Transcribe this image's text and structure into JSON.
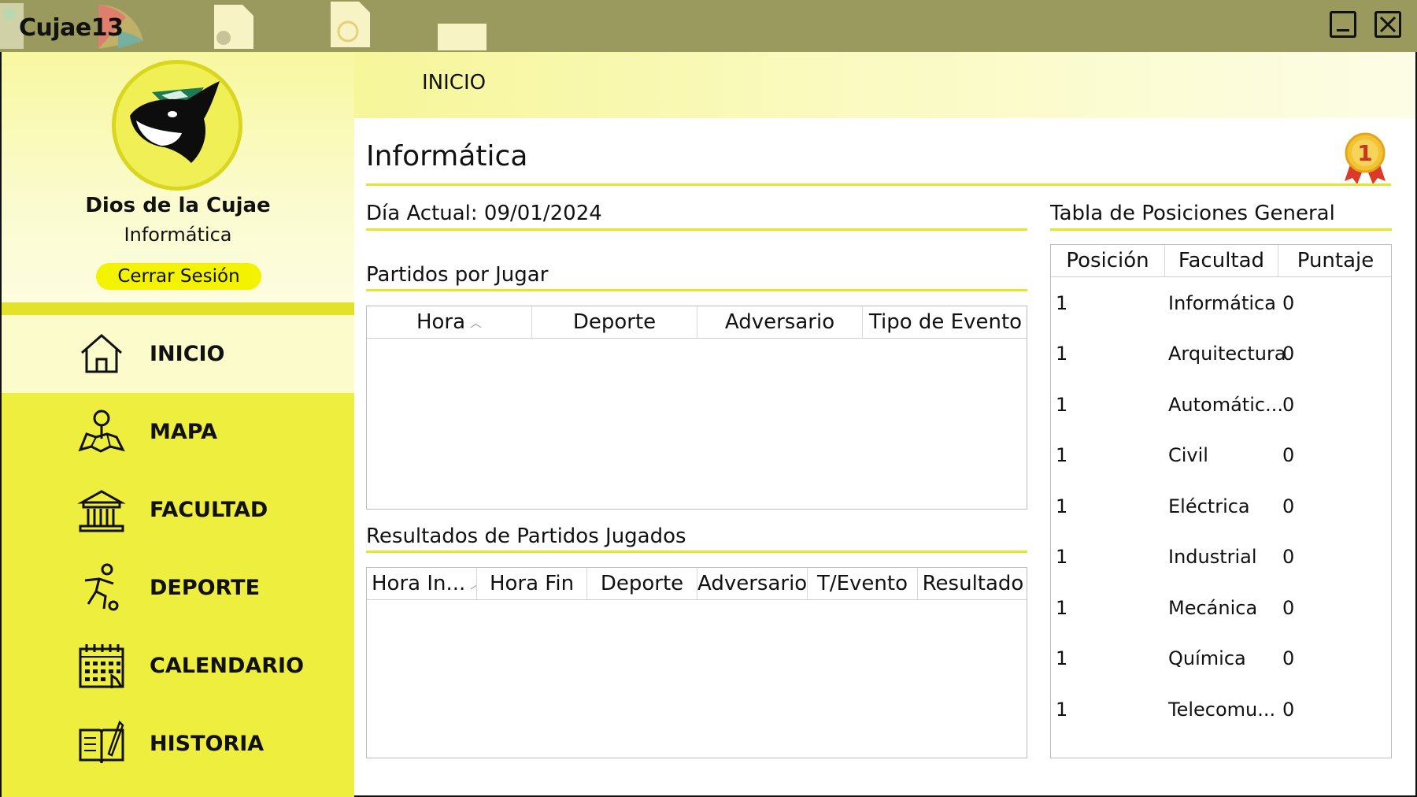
{
  "window": {
    "title": "Cujae13"
  },
  "user": {
    "name": "Dios de la Cujae",
    "faculty": "Informática",
    "logout_label": "Cerrar Sesión"
  },
  "nav": [
    {
      "label": "INICIO",
      "icon": "home-icon",
      "active": true
    },
    {
      "label": "MAPA",
      "icon": "map-icon",
      "active": false
    },
    {
      "label": "FACULTAD",
      "icon": "building-icon",
      "active": false
    },
    {
      "label": "DEPORTE",
      "icon": "soccer-player-icon",
      "active": false
    },
    {
      "label": "CALENDARIO",
      "icon": "calendar-icon",
      "active": false
    },
    {
      "label": "HISTORIA",
      "icon": "book-icon",
      "active": false
    }
  ],
  "header": {
    "title": "INICIO"
  },
  "main": {
    "title": "Informática",
    "current_day": "Día Actual: 09/01/2024",
    "upcoming": {
      "title": "Partidos por Jugar",
      "columns": [
        "Hora",
        "Deporte",
        "Adversario",
        "Tipo de Evento"
      ],
      "rows": []
    },
    "results": {
      "title": "Resultados de Partidos Jugados",
      "columns": [
        "Hora In...",
        "Hora Fin",
        "Deporte",
        "Adversario",
        "T/Evento",
        "Resultado"
      ],
      "rows": []
    },
    "standings": {
      "title": "Tabla de Posiciones General",
      "columns": [
        "Posición",
        "Facultad",
        "Puntaje"
      ],
      "rows": [
        [
          "1",
          "Informática",
          "0"
        ],
        [
          "1",
          "Arquitectura",
          "0"
        ],
        [
          "1",
          "Automátic...",
          "0"
        ],
        [
          "1",
          "Civil",
          "0"
        ],
        [
          "1",
          "Eléctrica",
          "0"
        ],
        [
          "1",
          "Industrial",
          "0"
        ],
        [
          "1",
          "Mecánica",
          "0"
        ],
        [
          "1",
          "Química",
          "0"
        ],
        [
          "1",
          "Telecomu...",
          "0"
        ]
      ]
    },
    "medal_text": "1"
  },
  "colors": {
    "sidebar": "#eeee3e",
    "accent": "#e5e52a",
    "titlebar": "#9b9a5e",
    "logout": "#f3f300"
  }
}
